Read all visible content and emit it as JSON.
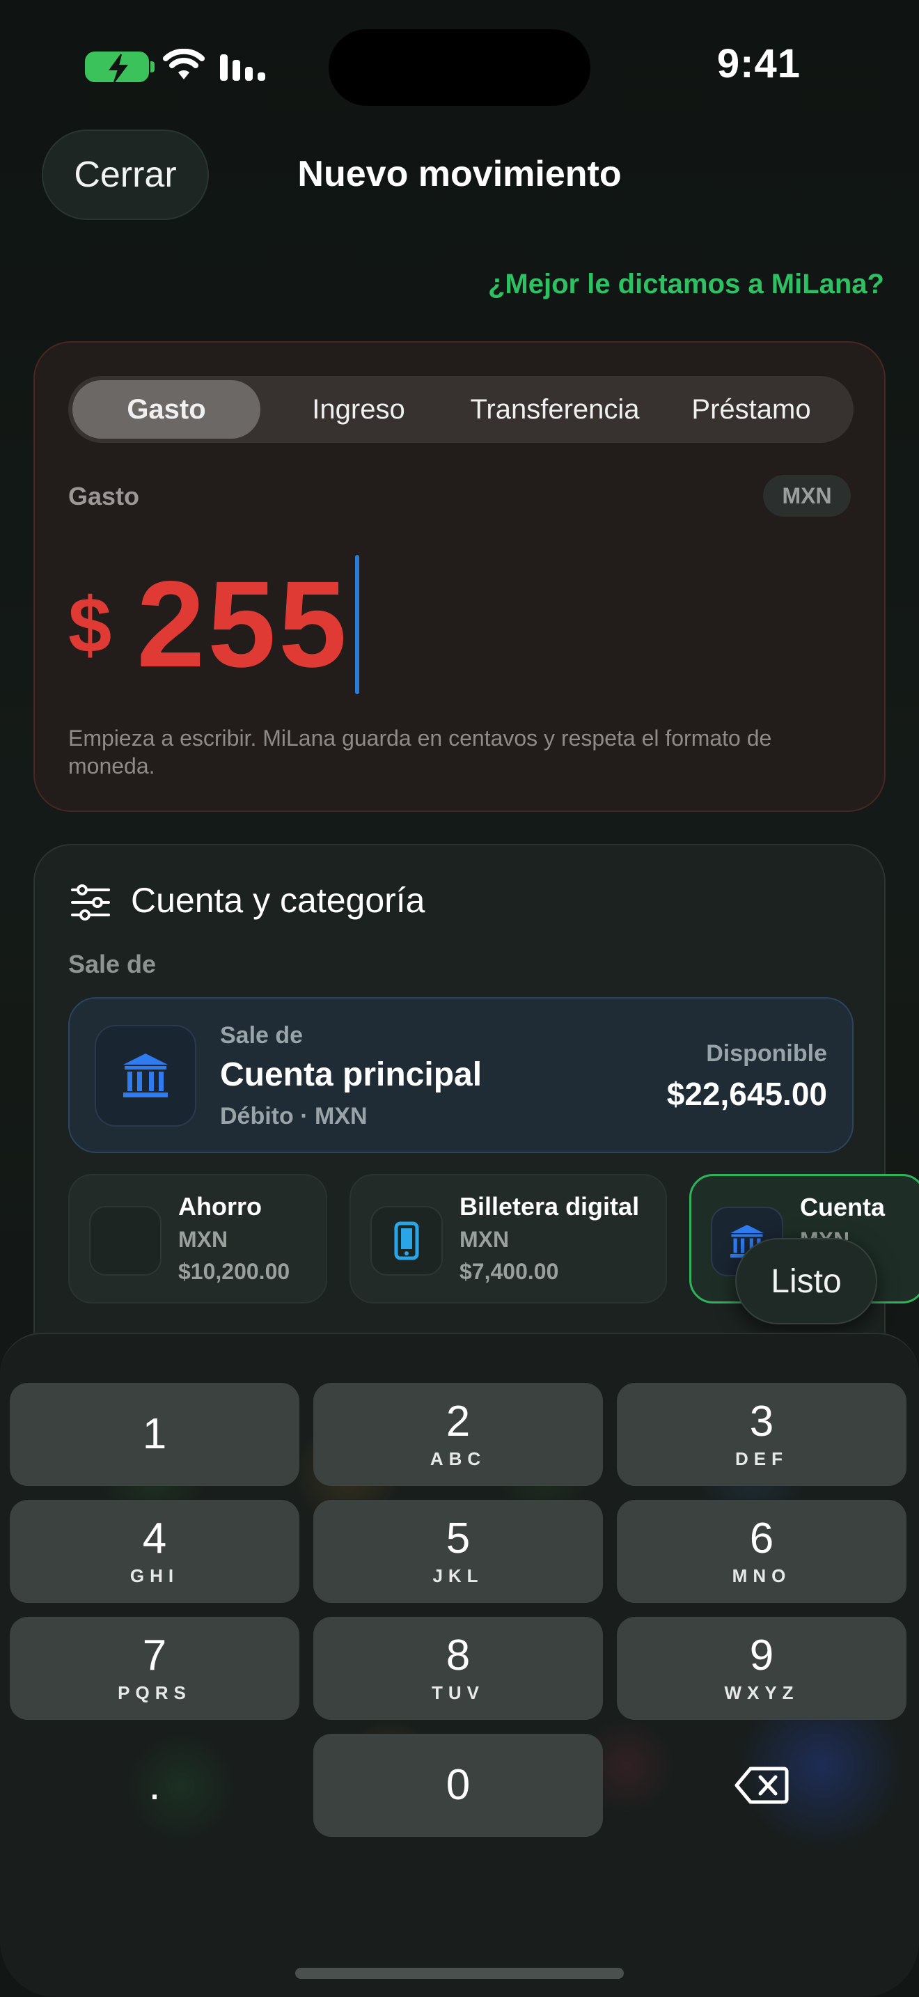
{
  "status_bar": {
    "time": "9:41"
  },
  "header": {
    "close_label": "Cerrar",
    "title": "Nuevo movimiento",
    "dictate_link": "¿Mejor le dictamos a MiLana?"
  },
  "amount_card": {
    "tabs": [
      {
        "label": "Gasto",
        "active": true
      },
      {
        "label": "Ingreso",
        "active": false
      },
      {
        "label": "Transferencia",
        "active": false
      },
      {
        "label": "Préstamo",
        "active": false
      }
    ],
    "type_label": "Gasto",
    "currency": "MXN",
    "symbol": "$",
    "amount": "255",
    "hint": "Empieza a escribir. MiLana guarda en centavos y respeta el formato de moneda.",
    "accent_color": "#e03a35"
  },
  "account_section": {
    "title": "Cuenta y categoría",
    "from_label": "Sale de",
    "primary": {
      "overline": "Sale de",
      "name": "Cuenta principal",
      "meta": "Débito · MXN",
      "available_label": "Disponible",
      "balance": "$22,645.00",
      "icon": "bank-icon"
    },
    "accounts": [
      {
        "name": "Ahorro",
        "currency": "MXN",
        "balance": "$10,200.00",
        "icon": ""
      },
      {
        "name": "Billetera digital",
        "currency": "MXN",
        "balance": "$7,400.00",
        "icon": "phone-icon"
      },
      {
        "name": "Cuenta",
        "currency": "MXN",
        "balance": "$",
        "icon": "bank-icon",
        "selected": true
      }
    ],
    "done_label": "Listo"
  },
  "keyboard": {
    "keys": [
      {
        "digit": "1",
        "letters": ""
      },
      {
        "digit": "2",
        "letters": "ABC"
      },
      {
        "digit": "3",
        "letters": "DEF"
      },
      {
        "digit": "4",
        "letters": "GHI"
      },
      {
        "digit": "5",
        "letters": "JKL"
      },
      {
        "digit": "6",
        "letters": "MNO"
      },
      {
        "digit": "7",
        "letters": "PQRS"
      },
      {
        "digit": "8",
        "letters": "TUV"
      },
      {
        "digit": "9",
        "letters": "WXYZ"
      },
      {
        "digit": ".",
        "letters": ""
      },
      {
        "digit": "0",
        "letters": ""
      }
    ]
  }
}
